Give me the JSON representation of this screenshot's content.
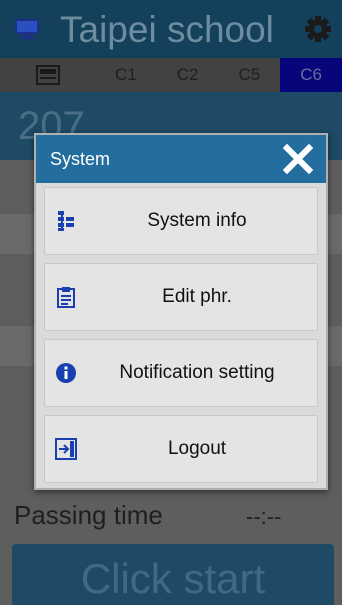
{
  "app": {
    "title": "Taipei school",
    "tabs": [
      {
        "label": "list",
        "kind": "list"
      },
      {
        "label": "C1"
      },
      {
        "label": "C2"
      },
      {
        "label": "C5"
      },
      {
        "label": "C6",
        "active": true
      }
    ],
    "room": "207",
    "passing_label": "Passing time",
    "passing_value": "--:--",
    "start_label": "Click start"
  },
  "dialog": {
    "title": "System",
    "items": [
      {
        "label": "System info",
        "icon": "system-info-icon"
      },
      {
        "label": "Edit phr.",
        "icon": "clipboard-icon"
      },
      {
        "label": "Notification setting",
        "icon": "info-icon"
      },
      {
        "label": "Logout",
        "icon": "logout-icon"
      }
    ]
  },
  "colors": {
    "header_blue": "#236e9e",
    "title_bar": "#13405a",
    "active_tab": "#06067a",
    "icon_blue": "#1a3fb0"
  }
}
